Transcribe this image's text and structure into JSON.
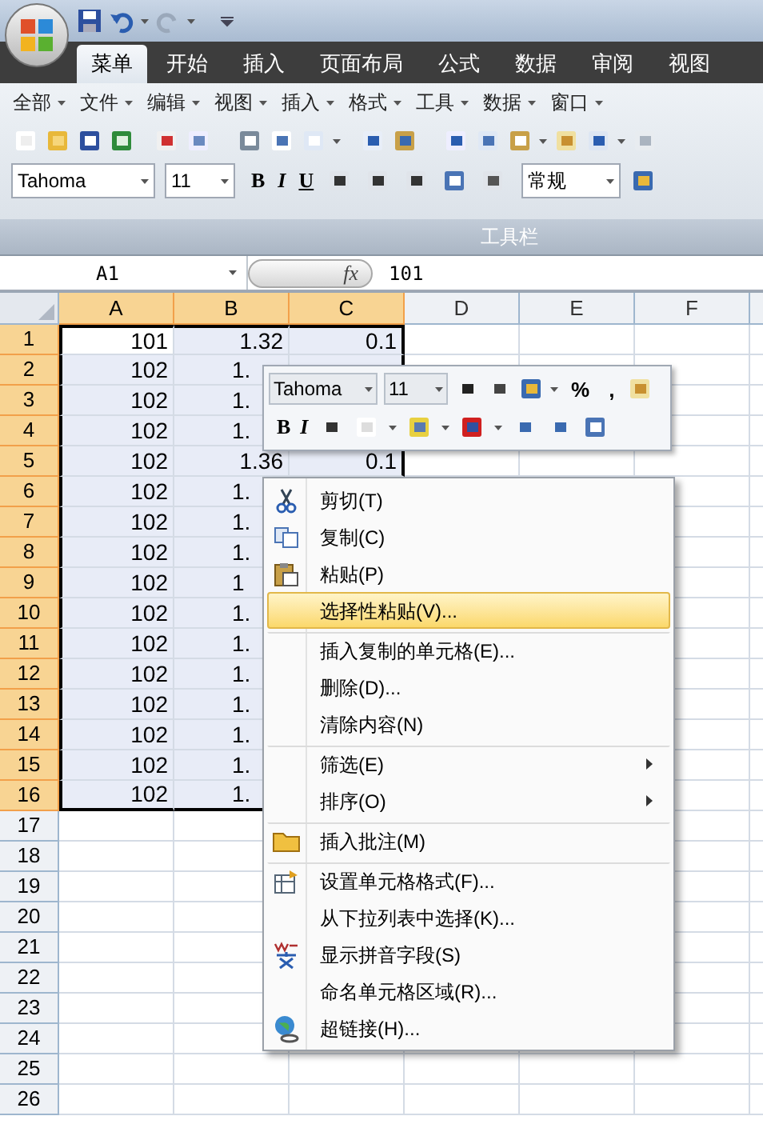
{
  "tabs": [
    {
      "label": "菜单",
      "selected": true
    },
    {
      "label": "开始",
      "selected": false
    },
    {
      "label": "插入",
      "selected": false
    },
    {
      "label": "页面布局",
      "selected": false
    },
    {
      "label": "公式",
      "selected": false
    },
    {
      "label": "数据",
      "selected": false
    },
    {
      "label": "审阅",
      "selected": false
    },
    {
      "label": "视图",
      "selected": false
    }
  ],
  "menus": [
    "全部",
    "文件",
    "编辑",
    "视图",
    "插入",
    "格式",
    "工具",
    "数据",
    "窗口"
  ],
  "font_row": {
    "font": "Tahoma",
    "size": "11",
    "format_buttons": [
      "B",
      "I",
      "U"
    ],
    "number_format": "常规"
  },
  "group_label": "工具栏",
  "formula_bar": {
    "name_box": "A1",
    "fx": "fx",
    "value": "101"
  },
  "columns": [
    {
      "label": "A",
      "selected": true
    },
    {
      "label": "B",
      "selected": true
    },
    {
      "label": "C",
      "selected": true
    },
    {
      "label": "D",
      "selected": false
    },
    {
      "label": "E",
      "selected": false
    },
    {
      "label": "F",
      "selected": false
    }
  ],
  "rows": [
    {
      "header": "1",
      "selected": true,
      "cells": [
        {
          "text": "101",
          "active": true
        },
        {
          "text": "1.32",
          "clipped": false
        },
        {
          "text": "0.1"
        }
      ]
    },
    {
      "header": "2",
      "selected": true,
      "cells": [
        {
          "text": "102",
          "active": false
        },
        {
          "text": "1.",
          "clipped": true
        }
      ]
    },
    {
      "header": "3",
      "selected": true,
      "cells": [
        {
          "text": "102",
          "active": false
        },
        {
          "text": "1.",
          "clipped": true
        }
      ]
    },
    {
      "header": "4",
      "selected": true,
      "cells": [
        {
          "text": "102",
          "active": false
        },
        {
          "text": "1.",
          "clipped": true
        }
      ]
    },
    {
      "header": "5",
      "selected": true,
      "cells": [
        {
          "text": "102",
          "active": false
        },
        {
          "text": "1.36",
          "clipped": false
        },
        {
          "text": "0.1"
        }
      ]
    },
    {
      "header": "6",
      "selected": true,
      "cells": [
        {
          "text": "102",
          "active": false
        },
        {
          "text": "1.",
          "clipped": true
        }
      ]
    },
    {
      "header": "7",
      "selected": true,
      "cells": [
        {
          "text": "102",
          "active": false
        },
        {
          "text": "1.",
          "clipped": true
        }
      ]
    },
    {
      "header": "8",
      "selected": true,
      "cells": [
        {
          "text": "102",
          "active": false
        },
        {
          "text": "1.",
          "clipped": true
        }
      ]
    },
    {
      "header": "9",
      "selected": true,
      "cells": [
        {
          "text": "102",
          "active": false
        },
        {
          "text": "1",
          "clipped": true
        }
      ]
    },
    {
      "header": "10",
      "selected": true,
      "cells": [
        {
          "text": "102",
          "active": false
        },
        {
          "text": "1.",
          "clipped": true
        }
      ]
    },
    {
      "header": "11",
      "selected": true,
      "cells": [
        {
          "text": "102",
          "active": false
        },
        {
          "text": "1.",
          "clipped": true
        }
      ]
    },
    {
      "header": "12",
      "selected": true,
      "cells": [
        {
          "text": "102",
          "active": false
        },
        {
          "text": "1.",
          "clipped": true
        }
      ]
    },
    {
      "header": "13",
      "selected": true,
      "cells": [
        {
          "text": "102",
          "active": false
        },
        {
          "text": "1.",
          "clipped": true
        }
      ]
    },
    {
      "header": "14",
      "selected": true,
      "cells": [
        {
          "text": "102",
          "active": false
        },
        {
          "text": "1.",
          "clipped": true
        }
      ]
    },
    {
      "header": "15",
      "selected": true,
      "cells": [
        {
          "text": "102",
          "active": false
        },
        {
          "text": "1.",
          "clipped": true
        }
      ]
    },
    {
      "header": "16",
      "selected": true,
      "cells": [
        {
          "text": "102",
          "active": false
        },
        {
          "text": "1.",
          "clipped": true
        }
      ]
    },
    {
      "header": "17",
      "selected": false
    },
    {
      "header": "18",
      "selected": false
    },
    {
      "header": "19",
      "selected": false
    },
    {
      "header": "20",
      "selected": false
    },
    {
      "header": "21",
      "selected": false
    },
    {
      "header": "22",
      "selected": false
    },
    {
      "header": "23",
      "selected": false
    },
    {
      "header": "24",
      "selected": false
    },
    {
      "header": "25",
      "selected": false
    },
    {
      "header": "26",
      "selected": false
    }
  ],
  "mini_toolbar": {
    "font": "Tahoma",
    "size": "11",
    "symbols": [
      "%",
      ","
    ],
    "format_buttons": [
      "B",
      "I"
    ]
  },
  "context_menu": [
    {
      "label": "剪切(T)",
      "selected": false,
      "separator_before": false,
      "submenu": false
    },
    {
      "label": "复制(C)",
      "selected": false,
      "separator_before": false,
      "submenu": false
    },
    {
      "label": "粘贴(P)",
      "selected": false,
      "separator_before": false,
      "submenu": false
    },
    {
      "label": "选择性粘贴(V)...",
      "selected": true,
      "separator_before": false,
      "submenu": false
    },
    {
      "label": "插入复制的单元格(E)...",
      "selected": false,
      "separator_before": true,
      "submenu": false
    },
    {
      "label": "删除(D)...",
      "selected": false,
      "separator_before": false,
      "submenu": false
    },
    {
      "label": "清除内容(N)",
      "selected": false,
      "separator_before": false,
      "submenu": false
    },
    {
      "label": "筛选(E)",
      "selected": false,
      "separator_before": true,
      "submenu": true
    },
    {
      "label": "排序(O)",
      "selected": false,
      "separator_before": false,
      "submenu": true
    },
    {
      "label": "插入批注(M)",
      "selected": false,
      "separator_before": true,
      "submenu": false
    },
    {
      "label": "设置单元格格式(F)...",
      "selected": false,
      "separator_before": true,
      "submenu": false
    },
    {
      "label": "从下拉列表中选择(K)...",
      "selected": false,
      "separator_before": false,
      "submenu": false
    },
    {
      "label": "显示拼音字段(S)",
      "selected": false,
      "separator_before": false,
      "submenu": false
    },
    {
      "label": "命名单元格区域(R)...",
      "selected": false,
      "separator_before": false,
      "submenu": false
    },
    {
      "label": "超链接(H)...",
      "selected": false,
      "separator_before": false,
      "submenu": false
    }
  ]
}
